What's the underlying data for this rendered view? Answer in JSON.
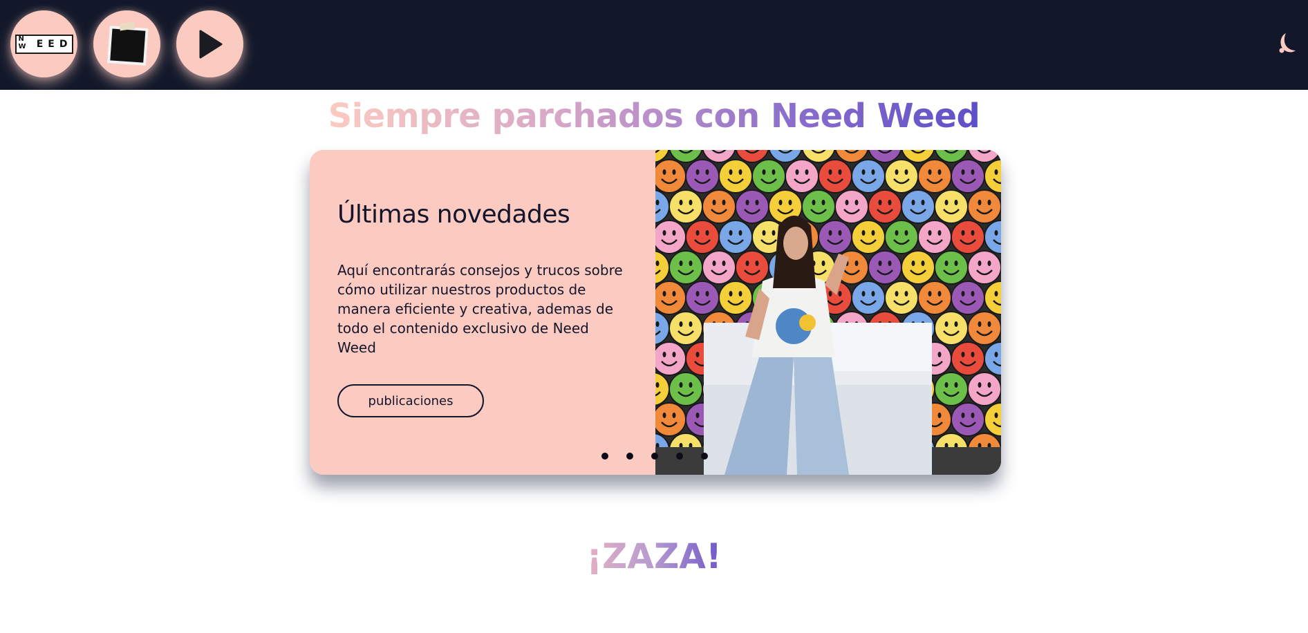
{
  "header": {
    "logo_letters": [
      "E",
      "E",
      "D"
    ],
    "logo_corner": [
      "N",
      "W"
    ],
    "brand_color": "#fbcbc1",
    "background_color": "#12182a",
    "buttons": [
      {
        "icon": "need-weed-logo-icon"
      },
      {
        "icon": "photo-note-icon"
      },
      {
        "icon": "play-icon"
      }
    ],
    "theme_toggle_icon": "moon-icon"
  },
  "hero": {
    "headline": "Siempre parchados con Need Weed"
  },
  "slide": {
    "title": "Últimas novedades",
    "description": "Aquí encontrarás consejos y trucos sobre cómo utilizar nuestros productos de manera eficiente y creativa, ademas de todo el contenido exclusivo de Need Weed",
    "button_label": "publicaciones",
    "image_icon": "smiley-wall-photo",
    "dots_count": 5,
    "active_dot": 1
  },
  "section": {
    "title": "¡ZAZA!"
  }
}
